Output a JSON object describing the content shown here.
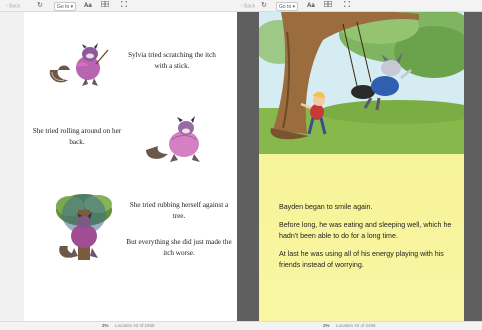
{
  "left_pane": {
    "toolbar": {
      "back_label": "Back",
      "goto_label": "Go to",
      "text_size_label": "Aa"
    },
    "story": {
      "para1": "Sylvia tried scratching the itch with a stick.",
      "para2": "She tried rolling around on her back.",
      "para3": "She tried rubbing herself against a tree.",
      "para4": "But everything she did just made the itch worse."
    },
    "status": {
      "percent": "2%",
      "location": "Location 42 of 2465"
    }
  },
  "right_pane": {
    "toolbar": {
      "back_label": "Back",
      "goto_label": "Go to",
      "text_size_label": "Aa"
    },
    "story": {
      "para1": "Bayden began to smile again.",
      "para2": "Before long, he was eating and sleeping well, which he hadn't been able to do for a long time.",
      "para3": "At last he was using all of his energy playing with his friends instead of worrying."
    },
    "status": {
      "percent": "2%",
      "location": "Location 42 of 2465"
    }
  },
  "icons": [
    "chevron-left-icon",
    "refresh-icon",
    "chevron-down-icon",
    "text-size-icon",
    "library-icon",
    "fullscreen-icon"
  ]
}
